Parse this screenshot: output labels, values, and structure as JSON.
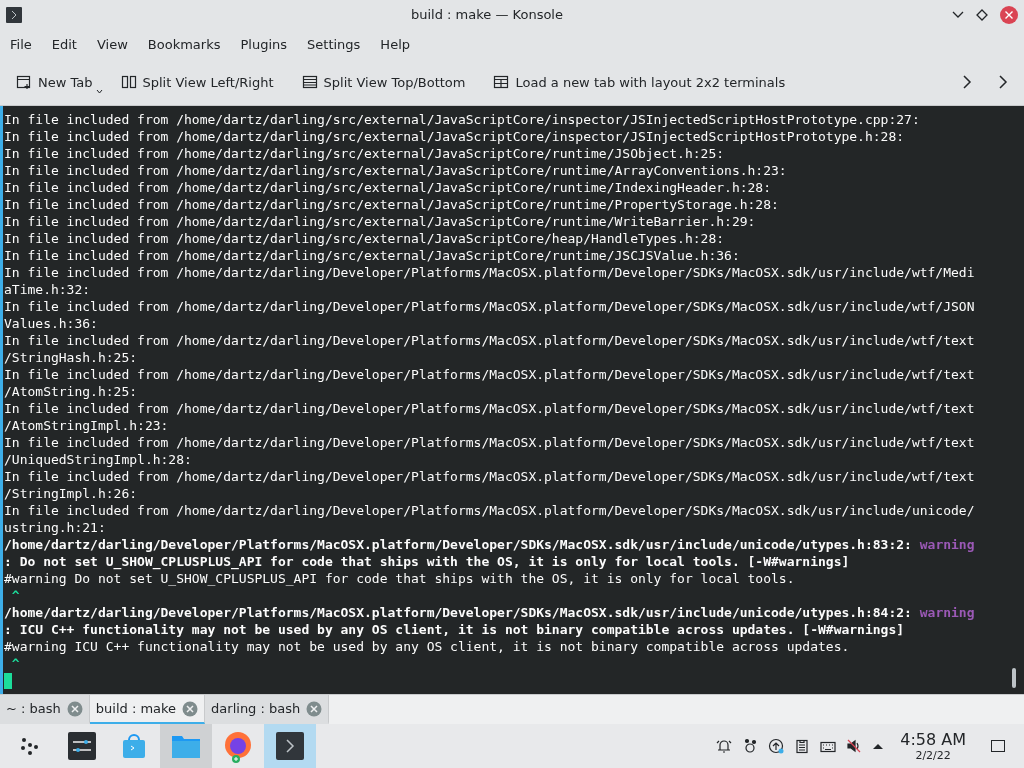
{
  "window": {
    "title": "build : make — Konsole"
  },
  "menu": [
    "File",
    "Edit",
    "View",
    "Bookmarks",
    "Plugins",
    "Settings",
    "Help"
  ],
  "toolbar": [
    {
      "kind": "new-tab",
      "label": "New Tab",
      "dropdown": true
    },
    {
      "kind": "split-columns",
      "label": "Split View Left/Right",
      "dropdown": false
    },
    {
      "kind": "split-rows",
      "label": "Split View Top/Bottom",
      "dropdown": false
    },
    {
      "kind": "grid",
      "label": "Load a new tab with layout 2x2 terminals",
      "dropdown": false
    }
  ],
  "terminal": {
    "lines": [
      {
        "kind": "plain",
        "text": "In file included from /home/dartz/darling/src/external/JavaScriptCore/inspector/JSInjectedScriptHostPrototype.cpp:27:"
      },
      {
        "kind": "plain",
        "text": "In file included from /home/dartz/darling/src/external/JavaScriptCore/inspector/JSInjectedScriptHostPrototype.h:28:"
      },
      {
        "kind": "plain",
        "text": "In file included from /home/dartz/darling/src/external/JavaScriptCore/runtime/JSObject.h:25:"
      },
      {
        "kind": "plain",
        "text": "In file included from /home/dartz/darling/src/external/JavaScriptCore/runtime/ArrayConventions.h:23:"
      },
      {
        "kind": "plain",
        "text": "In file included from /home/dartz/darling/src/external/JavaScriptCore/runtime/IndexingHeader.h:28:"
      },
      {
        "kind": "plain",
        "text": "In file included from /home/dartz/darling/src/external/JavaScriptCore/runtime/PropertyStorage.h:28:"
      },
      {
        "kind": "plain",
        "text": "In file included from /home/dartz/darling/src/external/JavaScriptCore/runtime/WriteBarrier.h:29:"
      },
      {
        "kind": "plain",
        "text": "In file included from /home/dartz/darling/src/external/JavaScriptCore/heap/HandleTypes.h:28:"
      },
      {
        "kind": "plain",
        "text": "In file included from /home/dartz/darling/src/external/JavaScriptCore/runtime/JSCJSValue.h:36:"
      },
      {
        "kind": "plain",
        "text": "In file included from /home/dartz/darling/Developer/Platforms/MacOSX.platform/Developer/SDKs/MacOSX.sdk/usr/include/wtf/Medi"
      },
      {
        "kind": "plain",
        "text": "aTime.h:32:"
      },
      {
        "kind": "plain",
        "text": "In file included from /home/dartz/darling/Developer/Platforms/MacOSX.platform/Developer/SDKs/MacOSX.sdk/usr/include/wtf/JSON"
      },
      {
        "kind": "plain",
        "text": "Values.h:36:"
      },
      {
        "kind": "plain",
        "text": "In file included from /home/dartz/darling/Developer/Platforms/MacOSX.platform/Developer/SDKs/MacOSX.sdk/usr/include/wtf/text"
      },
      {
        "kind": "plain",
        "text": "/StringHash.h:25:"
      },
      {
        "kind": "plain",
        "text": "In file included from /home/dartz/darling/Developer/Platforms/MacOSX.platform/Developer/SDKs/MacOSX.sdk/usr/include/wtf/text"
      },
      {
        "kind": "plain",
        "text": "/AtomString.h:25:"
      },
      {
        "kind": "plain",
        "text": "In file included from /home/dartz/darling/Developer/Platforms/MacOSX.platform/Developer/SDKs/MacOSX.sdk/usr/include/wtf/text"
      },
      {
        "kind": "plain",
        "text": "/AtomStringImpl.h:23:"
      },
      {
        "kind": "plain",
        "text": "In file included from /home/dartz/darling/Developer/Platforms/MacOSX.platform/Developer/SDKs/MacOSX.sdk/usr/include/wtf/text"
      },
      {
        "kind": "plain",
        "text": "/UniquedStringImpl.h:28:"
      },
      {
        "kind": "plain",
        "text": "In file included from /home/dartz/darling/Developer/Platforms/MacOSX.platform/Developer/SDKs/MacOSX.sdk/usr/include/wtf/text"
      },
      {
        "kind": "plain",
        "text": "/StringImpl.h:26:"
      },
      {
        "kind": "plain",
        "text": "In file included from /home/dartz/darling/Developer/Platforms/MacOSX.platform/Developer/SDKs/MacOSX.sdk/usr/include/unicode/"
      },
      {
        "kind": "plain",
        "text": "ustring.h:21:"
      },
      {
        "kind": "location",
        "text": "/home/dartz/darling/Developer/Platforms/MacOSX.platform/Developer/SDKs/MacOSX.sdk/usr/include/unicode/utypes.h:83:2:",
        "tag": "warning"
      },
      {
        "kind": "bold",
        "text": ": Do not set U_SHOW_CPLUSPLUS_API for code that ships with the OS, it is only for local tools. [-W#warnings]"
      },
      {
        "kind": "plain",
        "text": "#warning Do not set U_SHOW_CPLUSPLUS_API for code that ships with the OS, it is only for local tools."
      },
      {
        "kind": "caret",
        "text": " ^"
      },
      {
        "kind": "location",
        "text": "/home/dartz/darling/Developer/Platforms/MacOSX.platform/Developer/SDKs/MacOSX.sdk/usr/include/unicode/utypes.h:84:2:",
        "tag": "warning"
      },
      {
        "kind": "bold",
        "text": ": ICU C++ functionality may not be used by any OS client, it is not binary compatible across updates. [-W#warnings]"
      },
      {
        "kind": "plain",
        "text": "#warning ICU C++ functionality may not be used by any OS client, it is not binary compatible across updates."
      },
      {
        "kind": "caret",
        "text": " ^"
      },
      {
        "kind": "cursor"
      }
    ]
  },
  "tabs": [
    {
      "label": "~ : bash",
      "selected": false
    },
    {
      "label": "build : make",
      "selected": true
    },
    {
      "label": "darling : bash",
      "selected": false
    }
  ],
  "taskbar": {
    "items": [
      {
        "kind": "launcher",
        "running": false,
        "selected": false
      },
      {
        "kind": "sliders",
        "running": false,
        "selected": false
      },
      {
        "kind": "bag",
        "running": false,
        "selected": false
      },
      {
        "kind": "folder",
        "running": true,
        "selected": false
      },
      {
        "kind": "browser",
        "running": false,
        "selected": false
      },
      {
        "kind": "terminal",
        "running": true,
        "selected": true
      }
    ],
    "tray": [
      {
        "kind": "bell"
      },
      {
        "kind": "network"
      },
      {
        "kind": "update"
      },
      {
        "kind": "clipboard"
      },
      {
        "kind": "keyboard"
      },
      {
        "kind": "muted"
      },
      {
        "kind": "expand"
      }
    ],
    "time": "4:58 AM",
    "date": "2/2/22"
  }
}
